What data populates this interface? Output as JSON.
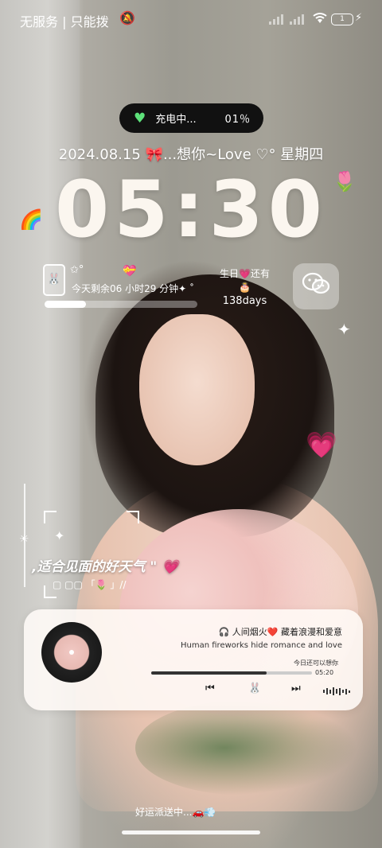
{
  "status_bar": {
    "carrier": "无服务 | 只能拨",
    "mute_icon": "bell-muted-icon",
    "wifi_icon": "wifi-icon",
    "battery": "1",
    "charging_icon": "bolt-icon"
  },
  "charge_pill": {
    "label": "充电中...",
    "percent": "01％",
    "icon": "green-heart-icon"
  },
  "date_line": "2024.08.15 🎀...想你~Love ♡° 星期四",
  "clock": "05:30",
  "countdown_widget": {
    "text": "今天剩余06 小时29 分钟✦ ˚",
    "star": "✩°",
    "progress": 0.27
  },
  "birthday_widget": {
    "line1": "生日💗还有",
    "cake": "🎂",
    "days": "138days"
  },
  "weather": {
    "title": ",适合见面的好天气 \"",
    "heart": "💗",
    "subtitle": "▢ ▢▢ 「🌷 」//"
  },
  "music": {
    "title": "🎧 人间烟火❤️ 藏着浪漫和爱意",
    "title_en": "Human fireworks hide romance and love",
    "note": "今日还可以想你",
    "time": "05:20",
    "progress": 0.72,
    "prev_icon": "skip-previous-icon",
    "next_icon": "skip-next-icon",
    "center_icon": "bunny-icon",
    "prev_glyph": "⏮",
    "next_glyph": "⏭",
    "center_glyph": "🐰"
  },
  "footer": {
    "luck": "好运派送中...🚗💨"
  }
}
